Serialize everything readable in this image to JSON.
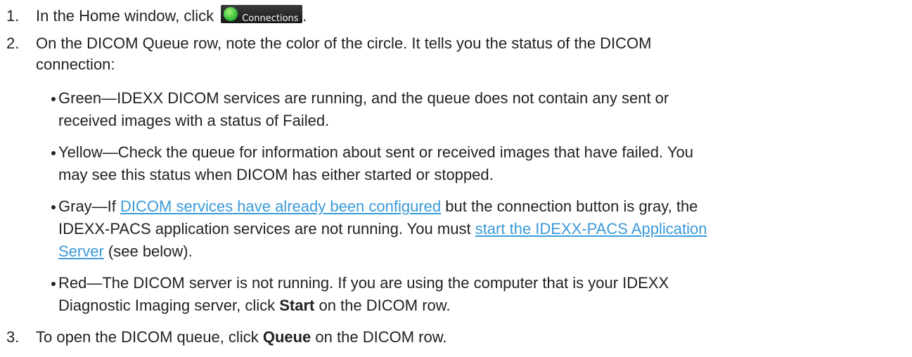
{
  "steps": [
    {
      "num": "1.",
      "pre": "In the Home window, click ",
      "button_label": "Connections",
      "post": "."
    },
    {
      "num": "2.",
      "line1": "On the DICOM Queue row, note the color of the circle. It tells you the status of the DICOM",
      "line2": "connection:"
    },
    {
      "num": "3.",
      "pre": "To open the DICOM queue, click ",
      "bold": "Queue",
      "post": " on the DICOM row."
    }
  ],
  "bullets": {
    "green": {
      "line1": "Green—IDEXX DICOM services are running, and the queue does not contain any sent or",
      "line2": "received images with a status of Failed."
    },
    "yellow": {
      "line1": "Yellow—Check the queue for information about sent or received images that have failed. You",
      "line2": "may see this status when DICOM has either started or stopped."
    },
    "gray": {
      "l1_pre": "Gray—If ",
      "l1_link": "DICOM services have already been configured",
      "l1_post": " but the connection button is gray, the",
      "l2_pre": "IDEXX-PACS application services are not running. You must ",
      "l2_link": "start the IDEXX-PACS Application",
      "l3_link": "Server",
      "l3_post": " (see below)."
    },
    "red": {
      "line1": "Red—The DICOM server is not running. If you are using the computer that is your IDEXX",
      "l2_pre": "Diagnostic Imaging server, click ",
      "l2_bold": "Start",
      "l2_post": " on the DICOM row."
    }
  },
  "colors": {
    "link": "#3a9ad9",
    "text": "#222222",
    "button_bg": "#2a2a2a",
    "button_circle": "#3cc23c"
  }
}
